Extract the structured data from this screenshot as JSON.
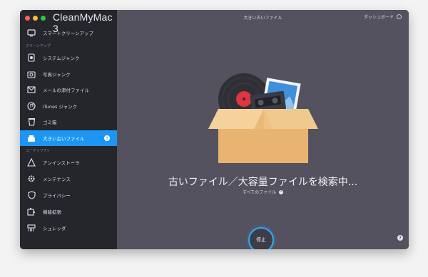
{
  "app": {
    "title": "CleanMyMac 3"
  },
  "sidebar": {
    "top_item": {
      "label": "スマートクリーンアップ",
      "icon": "monitor-icon"
    },
    "sections": [
      {
        "label": "クリーンアップ"
      },
      {
        "label": "ユーティリティ"
      }
    ],
    "cleanup_items": [
      {
        "label": "システムジャンク",
        "icon": "system-junk-icon"
      },
      {
        "label": "写真ジャンク",
        "icon": "camera-icon"
      },
      {
        "label": "メールの添付ファイル",
        "icon": "mail-icon"
      },
      {
        "label": "iTunes ジャンク",
        "icon": "music-note-icon"
      },
      {
        "label": "ゴミ箱",
        "icon": "trash-icon"
      },
      {
        "label": "大きい古いファイル",
        "icon": "large-files-icon",
        "active": true,
        "badge": "!"
      }
    ],
    "utility_items": [
      {
        "label": "アンインストーラ",
        "icon": "uninstaller-icon"
      },
      {
        "label": "メンテナンス",
        "icon": "gear-icon"
      },
      {
        "label": "プライバシー",
        "icon": "shield-icon"
      },
      {
        "label": "機能拡張",
        "icon": "puzzle-icon"
      },
      {
        "label": "シュレッダ",
        "icon": "shredder-icon"
      }
    ]
  },
  "main": {
    "header_title": "大きい古いファイル",
    "dashboard_label": "ダッシュボード",
    "status_text": "古いファイル／大容量ファイルを検索中...",
    "scope_label": "すべてのファイル",
    "stop_label": "停止",
    "help_label": "?"
  },
  "colors": {
    "accent": "#1d96f3",
    "sidebar_bg": "#25252c",
    "main_bg": "#53525e"
  }
}
